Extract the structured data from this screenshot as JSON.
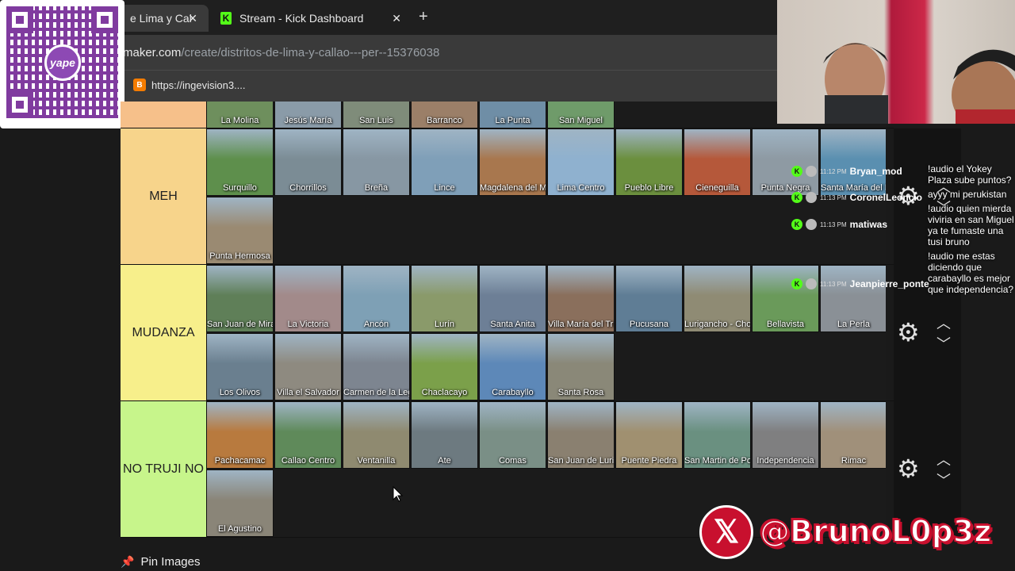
{
  "browser": {
    "tabs": [
      {
        "label": "e Lima y Cal",
        "close": "✕"
      },
      {
        "label": "Stream - Kick Dashboard",
        "close": "✕"
      }
    ],
    "new_tab": "+",
    "url_host": "rmaker.com",
    "url_path": "/create/distritos-de-lima-y-callao---per--15376038",
    "bookmark": "https://ingevision3...."
  },
  "qr": {
    "badge": "yape",
    "badge_small": "67"
  },
  "tiers": [
    {
      "label": "",
      "color": "#f6c08a",
      "items": [
        {
          "name": "La Molina",
          "color": "#6e8f5d"
        },
        {
          "name": "Jesús María",
          "color": "#8a9ba8"
        },
        {
          "name": "San Luis",
          "color": "#7f8c7a"
        },
        {
          "name": "Barranco",
          "color": "#9b7f68"
        },
        {
          "name": "La Punta",
          "color": "#6f8ea6"
        },
        {
          "name": "San Miguel",
          "color": "#6f9b6a"
        }
      ]
    },
    {
      "label": "MEH",
      "color": "#f7d48b",
      "items": [
        {
          "name": "Surquillo",
          "color": "#5e8f4c"
        },
        {
          "name": "Chorrillos",
          "color": "#7b8c95"
        },
        {
          "name": "Breña",
          "color": "#8797a3"
        },
        {
          "name": "Lince",
          "color": "#7f9fb8"
        },
        {
          "name": "Magdalena del Mar",
          "color": "#a8774e"
        },
        {
          "name": "Lima Centro",
          "color": "#8fb1cf"
        },
        {
          "name": "Pueblo Libre",
          "color": "#6b8f3e"
        },
        {
          "name": "Cieneguilla",
          "color": "#b5583a"
        },
        {
          "name": "Punta Negra",
          "color": "#8e9aa3"
        },
        {
          "name": "Santa María del Mar",
          "color": "#5a8fb0"
        },
        {
          "name": "Punta Hermosa",
          "color": "#9a8a72"
        }
      ]
    },
    {
      "label": "MUDANZA",
      "color": "#f7ef8b",
      "items": [
        {
          "name": "San Juan de Miraflores",
          "color": "#5f7f58"
        },
        {
          "name": "La Victoria",
          "color": "#a28a8a"
        },
        {
          "name": "Ancón",
          "color": "#7ea0b5"
        },
        {
          "name": "Lurín",
          "color": "#8a9a6a"
        },
        {
          "name": "Santa Anita",
          "color": "#6d7f96"
        },
        {
          "name": "Villa María del Triunfo",
          "color": "#8a6f5c"
        },
        {
          "name": "Pucusana",
          "color": "#5f7d95"
        },
        {
          "name": "Lurigancho - Chosica",
          "color": "#8f8b74"
        },
        {
          "name": "Bellavista",
          "color": "#6a9a5a"
        },
        {
          "name": "La Perla",
          "color": "#8a9096"
        },
        {
          "name": "Los Olivos",
          "color": "#6a7f8f"
        },
        {
          "name": "Villa el Salvador",
          "color": "#8e8a80"
        },
        {
          "name": "Carmen de la Legua - Reynoso",
          "color": "#7d8590"
        },
        {
          "name": "Chaclacayo",
          "color": "#7ba04a"
        },
        {
          "name": "Carabayllo",
          "color": "#5d88b8"
        },
        {
          "name": "Santa Rosa",
          "color": "#8a8878"
        }
      ]
    },
    {
      "label": "NO TRUJI NO",
      "color": "#c7f58b",
      "items": [
        {
          "name": "Pachacamac",
          "color": "#b87a3e"
        },
        {
          "name": "Callao Centro",
          "color": "#5f8a5a"
        },
        {
          "name": "Ventanilla",
          "color": "#8f8a70"
        },
        {
          "name": "Ate",
          "color": "#6d7a80"
        },
        {
          "name": "Comas",
          "color": "#7a8f86"
        },
        {
          "name": "San Juan de Lurigancho",
          "color": "#8a8070"
        },
        {
          "name": "Puente Piedra",
          "color": "#a09070"
        },
        {
          "name": "San Martin de Porres",
          "color": "#6a9080"
        },
        {
          "name": "Independencia",
          "color": "#7f7f80"
        },
        {
          "name": "Rimac",
          "color": "#a0907a"
        },
        {
          "name": "El Agustino",
          "color": "#8a8578"
        }
      ]
    }
  ],
  "chat_left": [
    {
      "time": "11:12 PM",
      "name": "Bryan_mod"
    },
    {
      "time": "11:13 PM",
      "name": "CoronelLeoncio"
    },
    {
      "time": "11:13 PM",
      "name": "matiwas"
    },
    {
      "time": "11:13 PM",
      "name": "Jeanpierre_ponte"
    }
  ],
  "chat_right": [
    "!audio el Yokey Plaza sube puntos?",
    "ayyy mi perukistan",
    "!audio quien mierda viviria en san Miguel ya te fumaste una tusi bruno",
    "!audio me estas diciendo que carabayllo es mejor que independencia?"
  ],
  "footer": {
    "pin_label": "Pin Images",
    "social_handle": "@BrunoL0p3z"
  }
}
